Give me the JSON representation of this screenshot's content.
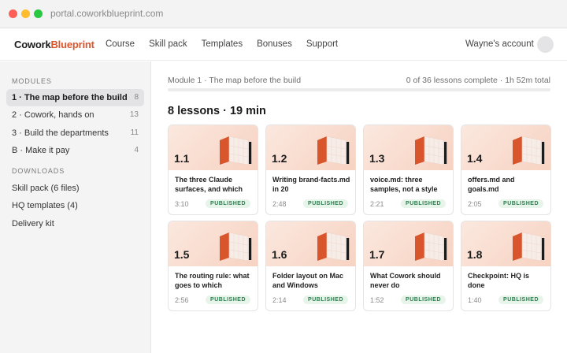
{
  "browser": {
    "url": "portal.coworkblueprint.com"
  },
  "brand": {
    "part1": "Cowork",
    "part2": "Blueprint",
    "accent": "#d9552c"
  },
  "nav": {
    "links": [
      "Course",
      "Skill pack",
      "Templates",
      "Bonuses",
      "Support"
    ],
    "account": "Wayne's account"
  },
  "sidebar": {
    "modules_heading": "MODULES",
    "modules": [
      {
        "label": "1 · The map before the build",
        "count": "8",
        "active": true
      },
      {
        "label": "2 · Cowork, hands on",
        "count": "13"
      },
      {
        "label": "3 · Build the departments",
        "count": "11"
      },
      {
        "label": "B · Make it pay",
        "count": "4"
      }
    ],
    "downloads_heading": "DOWNLOADS",
    "downloads": [
      "Skill pack (6 files)",
      "HQ templates (4)",
      "Delivery kit"
    ]
  },
  "main": {
    "breadcrumb": "Module 1 · The map before the build",
    "progress_text": "0 of 36 lessons complete · 1h 52m total",
    "progress_fraction": 0,
    "heading": "8 lessons · 19 min",
    "lessons": [
      {
        "num": "1.1",
        "title": "The three Claude surfaces, and which",
        "duration": "3:10",
        "status": "PUBLISHED"
      },
      {
        "num": "1.2",
        "title": "Writing brand-facts.md in 20",
        "duration": "2:48",
        "status": "PUBLISHED"
      },
      {
        "num": "1.3",
        "title": "voice.md: three samples, not a style",
        "duration": "2:21",
        "status": "PUBLISHED"
      },
      {
        "num": "1.4",
        "title": "offers.md and goals.md",
        "duration": "2:05",
        "status": "PUBLISHED"
      },
      {
        "num": "1.5",
        "title": "The routing rule: what goes to which",
        "duration": "2:56",
        "status": "PUBLISHED"
      },
      {
        "num": "1.6",
        "title": "Folder layout on Mac and Windows",
        "duration": "2:14",
        "status": "PUBLISHED"
      },
      {
        "num": "1.7",
        "title": "What Cowork should never do",
        "duration": "1:52",
        "status": "PUBLISHED"
      },
      {
        "num": "1.8",
        "title": "Checkpoint: HQ is done",
        "duration": "1:40",
        "status": "PUBLISHED"
      }
    ]
  }
}
